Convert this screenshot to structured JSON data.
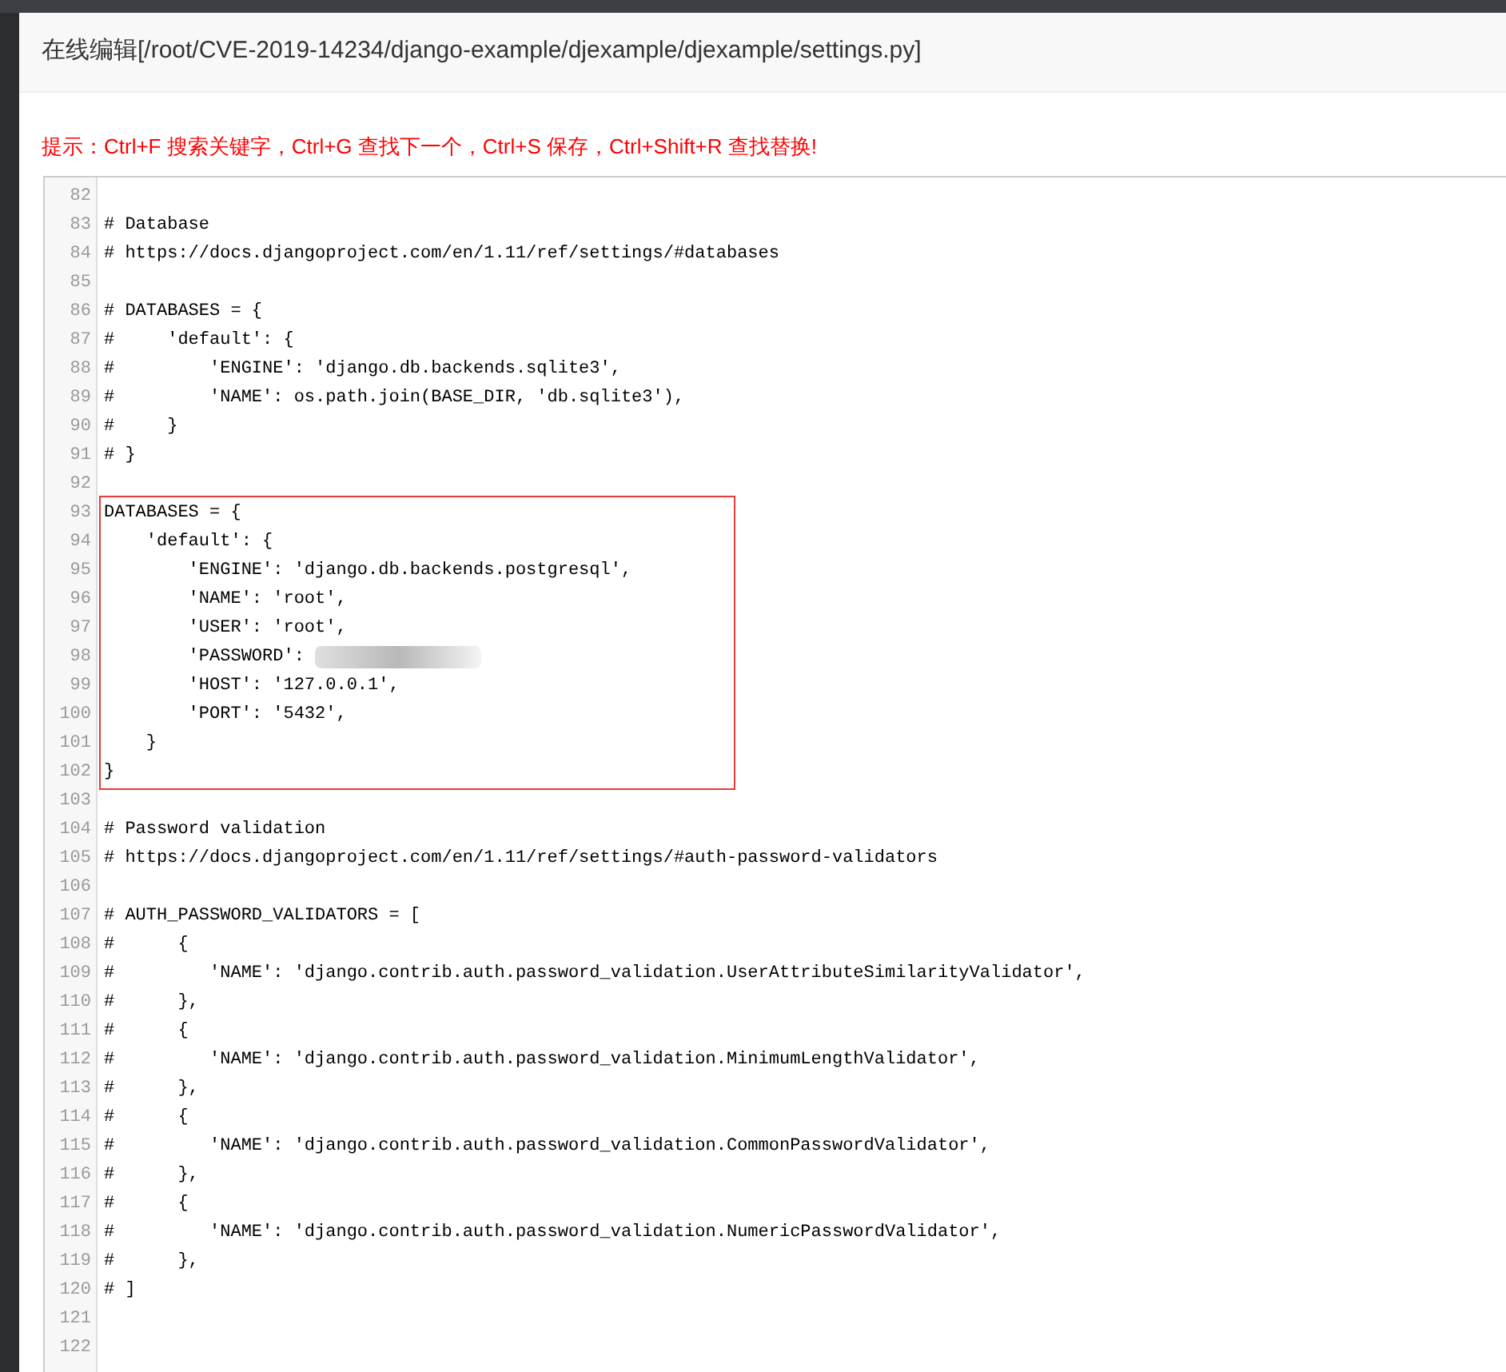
{
  "dialog": {
    "title": "在线编辑[/root/CVE-2019-14234/django-example/djexample/djexample/settings.py]",
    "hint": "提示：Ctrl+F 搜索关键字，Ctrl+G 查找下一个，Ctrl+S 保存，Ctrl+Shift+R 查找替换!"
  },
  "editor": {
    "lines_before": [
      {
        "number": "82"
      },
      {
        "number": "83",
        "text": "# Database"
      },
      {
        "number": "84",
        "text": "# https://docs.djangoproject.com/en/1.11/ref/settings/#databases"
      },
      {
        "number": "85"
      },
      {
        "number": "86",
        "text": "# DATABASES = {"
      },
      {
        "number": "87",
        "text": "#     'default': {"
      },
      {
        "number": "88",
        "text": "#         'ENGINE': 'django.db.backends.sqlite3',"
      },
      {
        "number": "89",
        "text": "#         'NAME': os.path.join(BASE_DIR, 'db.sqlite3'),"
      },
      {
        "number": "90",
        "text": "#     }"
      },
      {
        "number": "91",
        "text": "# }"
      },
      {
        "number": "92"
      }
    ],
    "highlight_box": {
      "lines": [
        {
          "number": "93",
          "text": "DATABASES = {"
        },
        {
          "number": "94",
          "text": "    'default': {"
        },
        {
          "number": "95",
          "text": "        'ENGINE': 'django.db.backends.postgresql',"
        },
        {
          "number": "96",
          "text": "        'NAME': 'root',"
        },
        {
          "number": "97",
          "text": "        'USER': 'root',"
        },
        {
          "number": "98",
          "text": "        'PASSWORD': ",
          "redacted": true
        },
        {
          "number": "99",
          "text": "        'HOST': '127.0.0.1',"
        },
        {
          "number": "100",
          "text": "        'PORT': '5432',"
        },
        {
          "number": "101",
          "text": "    }"
        },
        {
          "number": "102",
          "text": "}"
        }
      ]
    },
    "lines_after": [
      {
        "number": "103"
      },
      {
        "number": "104",
        "text": "# Password validation"
      },
      {
        "number": "105",
        "text": "# https://docs.djangoproject.com/en/1.11/ref/settings/#auth-password-validators"
      },
      {
        "number": "106"
      },
      {
        "number": "107",
        "text": "# AUTH_PASSWORD_VALIDATORS = ["
      },
      {
        "number": "108",
        "text": "#      {"
      },
      {
        "number": "109",
        "text": "#         'NAME': 'django.contrib.auth.password_validation.UserAttributeSimilarityValidator',"
      },
      {
        "number": "110",
        "text": "#      },"
      },
      {
        "number": "111",
        "text": "#      {"
      },
      {
        "number": "112",
        "text": "#         'NAME': 'django.contrib.auth.password_validation.MinimumLengthValidator',"
      },
      {
        "number": "113",
        "text": "#      },"
      },
      {
        "number": "114",
        "text": "#      {"
      },
      {
        "number": "115",
        "text": "#         'NAME': 'django.contrib.auth.password_validation.CommonPasswordValidator',"
      },
      {
        "number": "116",
        "text": "#      },"
      },
      {
        "number": "117",
        "text": "#      {"
      },
      {
        "number": "118",
        "text": "#         'NAME': 'django.contrib.auth.password_validation.NumericPasswordValidator',"
      },
      {
        "number": "119",
        "text": "#      },"
      },
      {
        "number": "120",
        "text": "# ]"
      },
      {
        "number": "121"
      },
      {
        "number": "122"
      }
    ]
  }
}
